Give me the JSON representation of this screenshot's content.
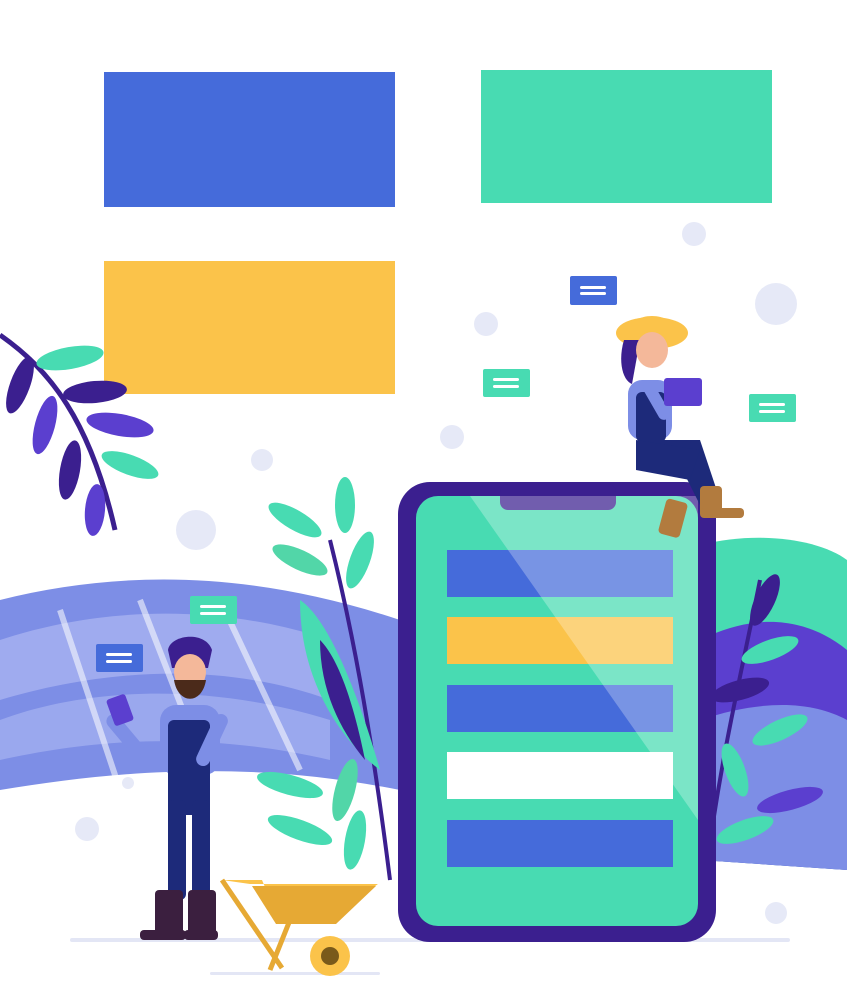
{
  "colors": {
    "blue": "#456bda",
    "green": "#48dbb2",
    "yellow": "#fbc34a",
    "purple_dark": "#3b1f8f",
    "purple": "#5b3fcf",
    "lavender": "#7d8ee6",
    "lavender_light": "#a7b3f1",
    "mint": "#52d6a8",
    "navy": "#1d2a7a",
    "dot": "#e6e9f7",
    "ground": "#e3e6f5",
    "white": "#ffffff"
  },
  "tiles": [
    {
      "id": "blue",
      "color_key": "blue"
    },
    {
      "id": "green",
      "color_key": "green"
    },
    {
      "id": "yellow",
      "color_key": "yellow"
    }
  ],
  "phone": {
    "rows": [
      "blue",
      "yellow",
      "blue",
      "white",
      "blue"
    ]
  },
  "icons": [
    "chat-bubble-icon",
    "tablet-icon",
    "smartphone-icon",
    "wheelbarrow-icon",
    "leaf-branch-icon"
  ]
}
